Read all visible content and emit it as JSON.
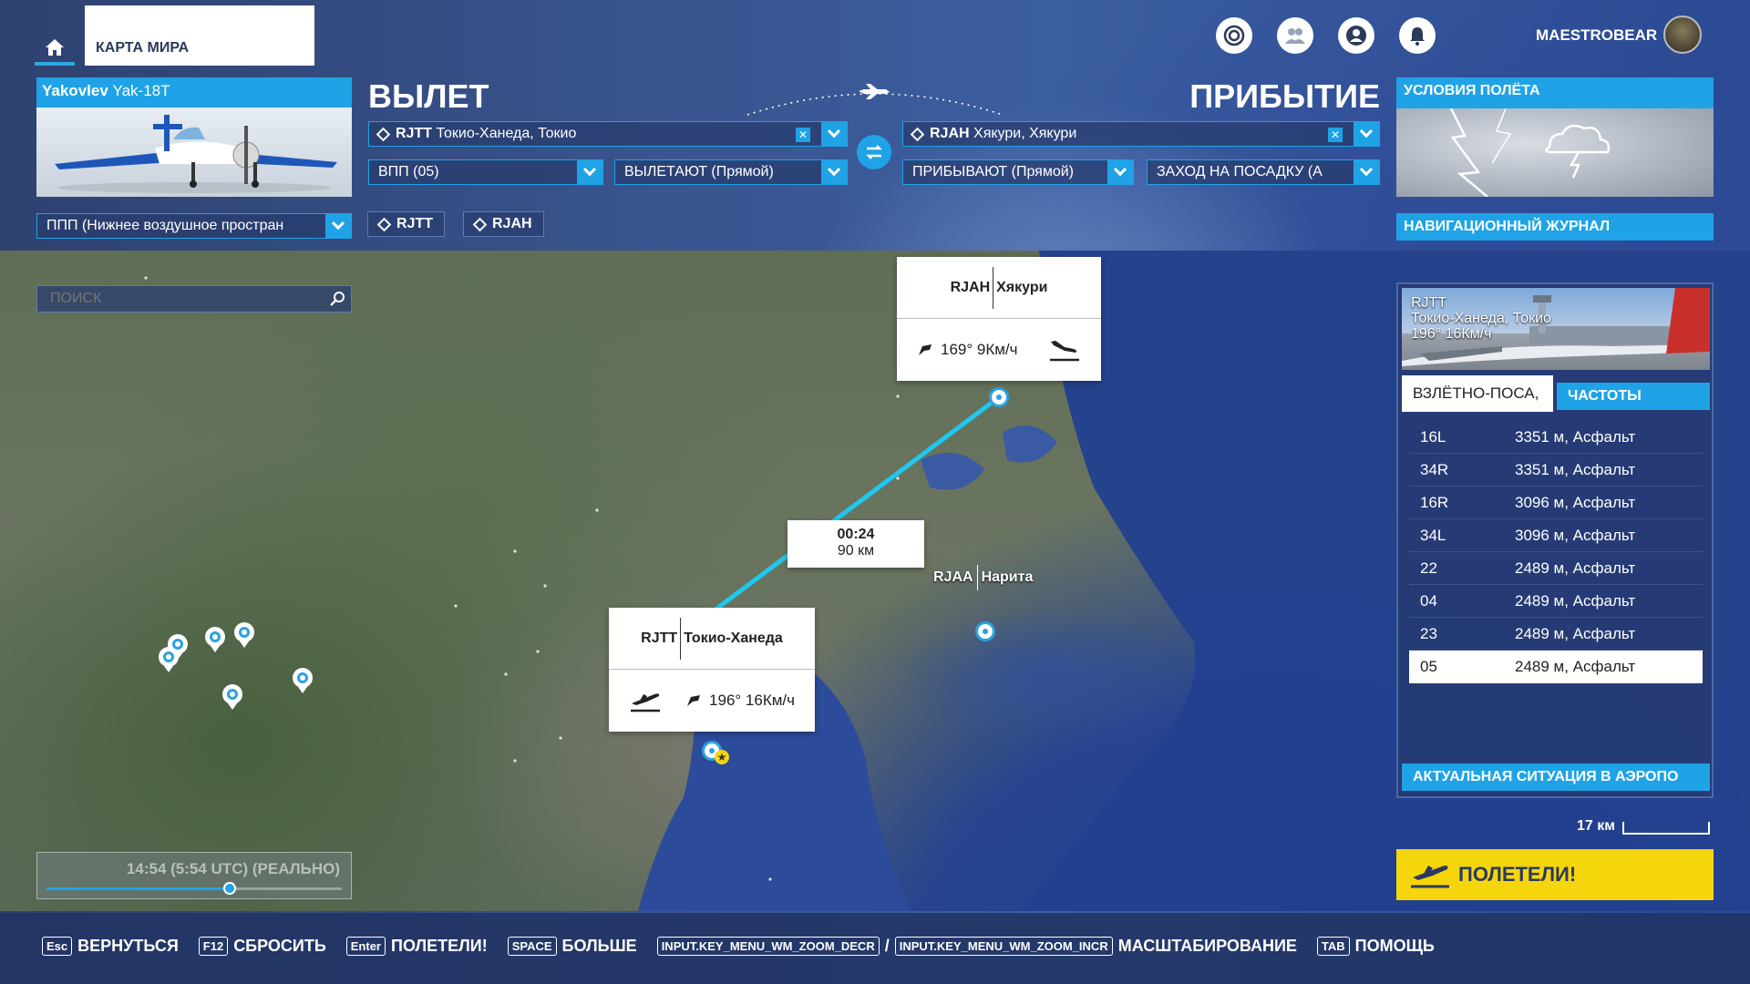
{
  "topbar": {
    "tab_label": "КАРТА МИРА",
    "username": "MAESTROBEAR",
    "icons": [
      "target-icon",
      "friends-icon",
      "profile-icon",
      "notifications-icon"
    ]
  },
  "aircraft": {
    "brand": "Yakovlev",
    "model": "Yak-18T"
  },
  "departure": {
    "heading": "ВЫЛЕТ",
    "airport_code": "RJTT",
    "airport_name": "Токио-Ханеда, Токио",
    "runway": "ВПП (05)",
    "departure_type": "ВЫЛЕТАЮТ (Прямой)"
  },
  "arrival": {
    "heading": "ПРИБЫТИЕ",
    "airport_code": "RJAH",
    "airport_name": "Хякури, Хякури",
    "arrival_type": "ПРИБЫВАЮТ (Прямой)",
    "approach": "ЗАХОД НА ПОСАДКУ (А"
  },
  "flight_conditions": {
    "label": "УСЛОВИЯ ПОЛЁТА"
  },
  "flight_rules": {
    "value": "ППП (Нижнее воздушное простран"
  },
  "waypoint_tags": [
    "RJTT",
    "RJAH"
  ],
  "nav_log": {
    "label": "НАВИГАЦИОННЫЙ ЖУРНАЛ"
  },
  "search": {
    "placeholder": "ПОИСК"
  },
  "map": {
    "arrival_card": {
      "code": "RJAH",
      "name": "Хякури",
      "wind": "169° 9Км/ч"
    },
    "departure_card": {
      "code": "RJTT",
      "name": "Токио-Ханеда",
      "wind": "196° 16Км/ч"
    },
    "route_label": {
      "time": "00:24",
      "distance": "90 км"
    },
    "narita_label": {
      "code": "RJAA",
      "name": "Нарита"
    }
  },
  "time_slider": {
    "label": "14:54 (5:54 UTC) (РЕАЛЬНО)",
    "position": 0.62
  },
  "airport_panel": {
    "code": "RJTT",
    "name": "Токио-Ханеда, Токио",
    "wind": "196° 16Км/ч",
    "tabs": [
      "ВЗЛЁТНО-ПОСА,",
      "ЧАСТОТЫ"
    ],
    "runways": [
      {
        "id": "16L",
        "info": "3351 м, Асфальт"
      },
      {
        "id": "34R",
        "info": "3351 м, Асфальт"
      },
      {
        "id": "16R",
        "info": "3096 м, Асфальт"
      },
      {
        "id": "34L",
        "info": "3096 м, Асфальт"
      },
      {
        "id": "22",
        "info": "2489 м, Асфальт"
      },
      {
        "id": "04",
        "info": "2489 м, Асфальт"
      },
      {
        "id": "23",
        "info": "2489 м, Асфальт"
      },
      {
        "id": "05",
        "info": "2489 м, Асфальт"
      }
    ],
    "selected_runway": "05",
    "situation_button": "АКТУАЛЬНАЯ СИТУАЦИЯ В АЭРОПО"
  },
  "scale": {
    "label": "17 км"
  },
  "fly_button": {
    "label": "ПОЛЕТЕЛИ!"
  },
  "bottom_bar": [
    {
      "key": "Esc",
      "label": "ВЕРНУТЬСЯ"
    },
    {
      "key": "F12",
      "label": "СБРОСИТЬ"
    },
    {
      "key": "Enter",
      "label": "ПОЛЕТЕЛИ!"
    },
    {
      "key": "SPACE",
      "label": "БОЛЬШЕ"
    },
    {
      "key": "INPUT.KEY_MENU_WM_ZOOM_DECR",
      "key2": "INPUT.KEY_MENU_WM_ZOOM_INCR",
      "label": "МАСШТАБИРОВАНИЕ"
    },
    {
      "key": "TAB",
      "label": "ПОМОЩЬ"
    }
  ],
  "colors": {
    "accent": "#1fa3e6",
    "route": "#1ec8f0",
    "fly_button": "#f5d60d"
  }
}
